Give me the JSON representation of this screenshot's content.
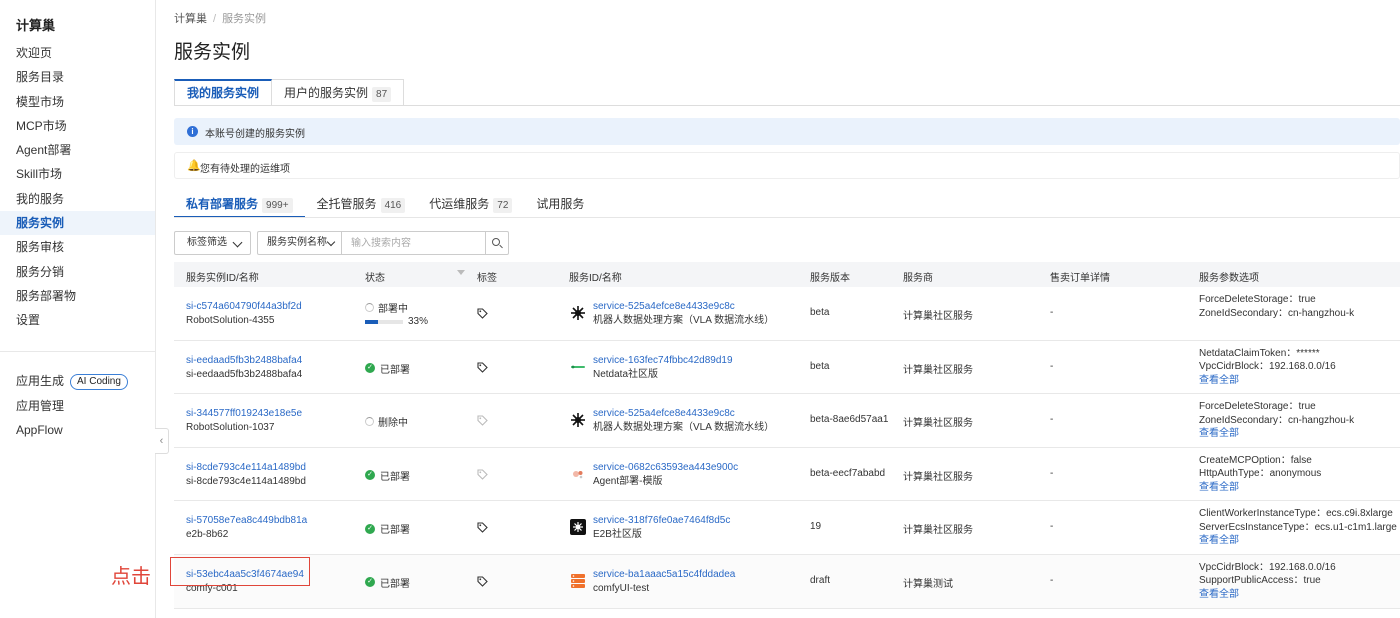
{
  "sidebar": {
    "brand": "计算巢",
    "items": [
      {
        "label": "欢迎页"
      },
      {
        "label": "服务目录"
      },
      {
        "label": "模型市场"
      },
      {
        "label": "MCP市场"
      },
      {
        "label": "Agent部署"
      },
      {
        "label": "Skill市场"
      },
      {
        "label": "我的服务"
      },
      {
        "label": "服务实例",
        "active": true
      },
      {
        "label": "服务审核"
      },
      {
        "label": "服务分销"
      },
      {
        "label": "服务部署物"
      },
      {
        "label": "设置"
      }
    ],
    "secondary": [
      {
        "label": "应用生成",
        "badge": "AI Coding"
      },
      {
        "label": "应用管理"
      },
      {
        "label": "AppFlow"
      }
    ]
  },
  "breadcrumb": {
    "root": "计算巢",
    "sep": "/",
    "current": "服务实例"
  },
  "page_title": "服务实例",
  "top_tabs": [
    {
      "label": "我的服务实例",
      "active": true
    },
    {
      "label": "用户的服务实例",
      "count": "87"
    }
  ],
  "info_banner": "本账号创建的服务实例",
  "warn_banner": "您有待处理的运维项",
  "sub_tabs": [
    {
      "label": "私有部署服务",
      "count": "999+",
      "active": true
    },
    {
      "label": "全托管服务",
      "count": "416"
    },
    {
      "label": "代运维服务",
      "count": "72"
    },
    {
      "label": "试用服务"
    }
  ],
  "filters": {
    "tag_filter": "标签筛选",
    "search_field": "服务实例名称",
    "search_placeholder": "输入搜索内容"
  },
  "table": {
    "headers": [
      "服务实例ID/名称",
      "状态",
      "标签",
      "服务ID/名称",
      "服务版本",
      "服务商",
      "售卖订单详情",
      "服务参数选项"
    ],
    "view_all": "查看全部",
    "rows": [
      {
        "id": "si-c574a604790f44a3bf2d",
        "name": "RobotSolution-4355",
        "status": "部署中",
        "status_type": "deploying",
        "progress": "33%",
        "service_id": "service-525a4efce8e4433e9c8c",
        "service_name": "机器人数据处理方案（VLA 数据流水线）",
        "service_icon": "robot-icon",
        "version": "beta",
        "vendor": "计算巢社区服务",
        "order": "-",
        "params": [
          "ForceDeleteStorage：true",
          "ZoneIdSecondary：cn-hangzhou-k"
        ]
      },
      {
        "id": "si-eedaad5fb3b2488bafa4",
        "name": "si-eedaad5fb3b2488bafa4",
        "status": "已部署",
        "status_type": "deployed",
        "service_id": "service-163fec74fbbc42d89d19",
        "service_name": "Netdata社区版",
        "service_icon": "netdata-icon",
        "version": "beta",
        "vendor": "计算巢社区服务",
        "order": "-",
        "params": [
          "NetdataClaimToken：******",
          "VpcCidrBlock：192.168.0.0/16"
        ]
      },
      {
        "id": "si-344577ff019243e18e5e",
        "name": "RobotSolution-1037",
        "status": "删除中",
        "status_type": "deleting",
        "service_id": "service-525a4efce8e4433e9c8c",
        "service_name": "机器人数据处理方案（VLA 数据流水线）",
        "service_icon": "robot-icon",
        "version": "beta-8ae6d57aa1",
        "vendor": "计算巢社区服务",
        "order": "-",
        "params": [
          "ForceDeleteStorage：true",
          "ZoneIdSecondary：cn-hangzhou-k"
        ]
      },
      {
        "id": "si-8cde793c4e114a1489bd",
        "name": "si-8cde793c4e114a1489bd",
        "status": "已部署",
        "status_type": "deployed",
        "service_id": "service-0682c63593ea443e900c",
        "service_name": "Agent部署-模版",
        "service_icon": "agent-icon",
        "version": "beta-eecf7ababd",
        "vendor": "计算巢社区服务",
        "order": "-",
        "params": [
          "CreateMCPOption：false",
          "HttpAuthType：anonymous"
        ]
      },
      {
        "id": "si-57058e7ea8c449bdb81a",
        "name": "e2b-8b62",
        "status": "已部署",
        "status_type": "deployed",
        "service_id": "service-318f76fe0ae7464f8d5c",
        "service_name": "E2B社区版",
        "service_icon": "e2b-icon",
        "version": "19",
        "vendor": "计算巢社区服务",
        "order": "-",
        "params": [
          "ClientWorkerInstanceType：ecs.c9i.8xlarge",
          "ServerEcsInstanceType：ecs.u1-c1m1.large"
        ]
      },
      {
        "id": "si-53ebc4aa5c3f4674ae94",
        "name": "comfy-c001",
        "status": "已部署",
        "status_type": "deployed",
        "service_id": "service-ba1aaac5a15c4fddadea",
        "service_name": "comfyUI-test",
        "service_icon": "server-stack-icon",
        "version": "draft",
        "vendor": "计算巢测试",
        "order": "-",
        "params": [
          "VpcCidrBlock：192.168.0.0/16",
          "SupportPublicAccess：true"
        ]
      }
    ]
  },
  "annotation": {
    "label": "点击",
    "color": "#e0463a"
  },
  "colors": {
    "accent": "#1a5db8",
    "link": "#2a69c6",
    "success": "#2fa84f",
    "alert": "#d83b2c"
  }
}
